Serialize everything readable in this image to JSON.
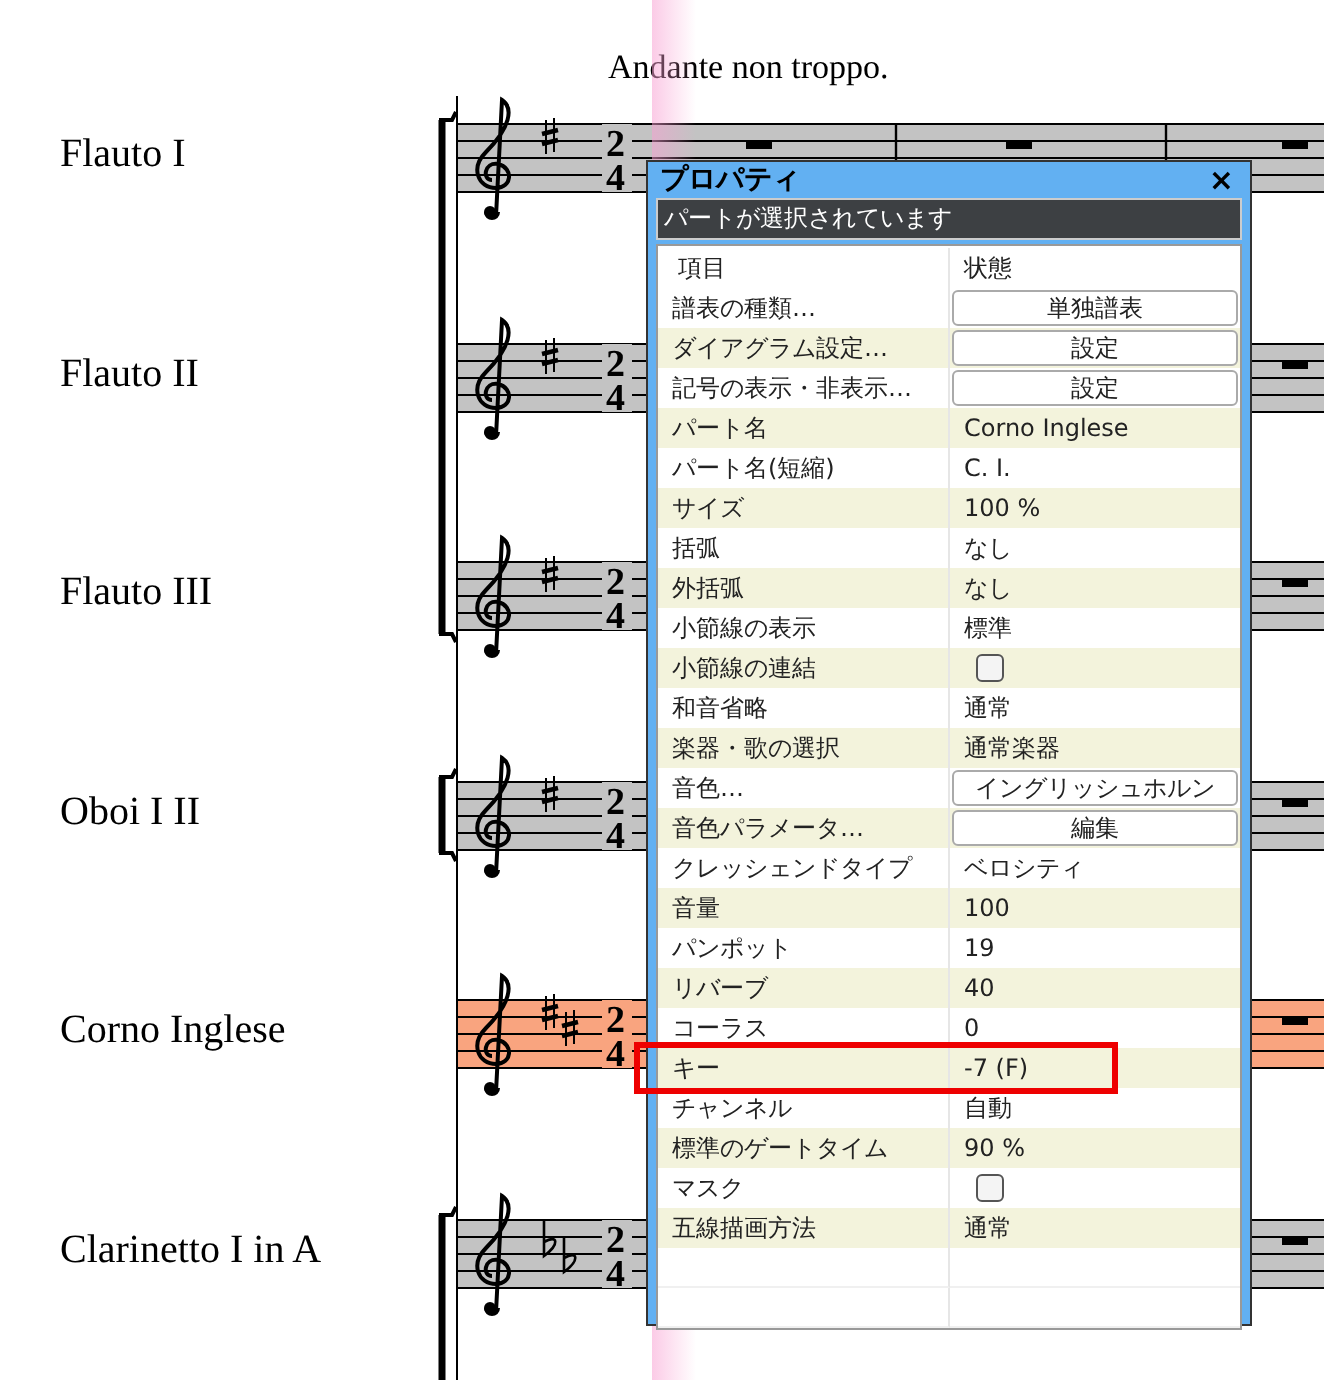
{
  "title": "Andante non troppo.",
  "staves": [
    {
      "name": "Flauto I",
      "accidentals": [
        {
          "kind": "sharp"
        }
      ],
      "time": [
        "2",
        "4"
      ],
      "selected": false
    },
    {
      "name": "Flauto II",
      "accidentals": [
        {
          "kind": "sharp"
        }
      ],
      "time": [
        "2",
        "4"
      ],
      "selected": false
    },
    {
      "name": "Flauto III",
      "accidentals": [
        {
          "kind": "sharp"
        }
      ],
      "time": [
        "2",
        "4"
      ],
      "selected": false
    },
    {
      "name": "Oboi I II",
      "accidentals": [
        {
          "kind": "sharp"
        }
      ],
      "time": [
        "2",
        "4"
      ],
      "selected": false
    },
    {
      "name": "Corno Inglese",
      "accidentals": [
        {
          "kind": "sharp"
        },
        {
          "kind": "sharp"
        }
      ],
      "time": [
        "2",
        "4"
      ],
      "selected": true
    },
    {
      "name": "Clarinetto I in A",
      "accidentals": [
        {
          "kind": "flat"
        },
        {
          "kind": "flat"
        }
      ],
      "time": [
        "2",
        "4"
      ],
      "selected": false
    }
  ],
  "panel": {
    "title": "プロパティ",
    "close": "×",
    "status": "パートが選択されています",
    "columns": [
      "項目",
      "状態"
    ],
    "rows": [
      {
        "label": "譜表の種類…",
        "value": "単独譜表",
        "kind": "button",
        "highlighted": false
      },
      {
        "label": "ダイアグラム設定…",
        "value": "設定",
        "kind": "button",
        "highlighted": false
      },
      {
        "label": "記号の表示・非表示…",
        "value": "設定",
        "kind": "button",
        "highlighted": false
      },
      {
        "label": "パート名",
        "value": "Corno Inglese",
        "kind": "text",
        "highlighted": false
      },
      {
        "label": "パート名(短縮)",
        "value": "C. I.",
        "kind": "text",
        "highlighted": false
      },
      {
        "label": "サイズ",
        "value": "100 %",
        "kind": "text",
        "highlighted": false
      },
      {
        "label": "括弧",
        "value": "なし",
        "kind": "text",
        "highlighted": false
      },
      {
        "label": "外括弧",
        "value": "なし",
        "kind": "text",
        "highlighted": false
      },
      {
        "label": "小節線の表示",
        "value": "標準",
        "kind": "text",
        "highlighted": false
      },
      {
        "label": "小節線の連結",
        "kind": "checkbox",
        "checked": false,
        "highlighted": false
      },
      {
        "label": "和音省略",
        "value": "通常",
        "kind": "text",
        "highlighted": false
      },
      {
        "label": "楽器・歌の選択",
        "value": "通常楽器",
        "kind": "text",
        "highlighted": false
      },
      {
        "label": "音色…",
        "value": "イングリッシュホルン",
        "kind": "button",
        "highlighted": false
      },
      {
        "label": "音色パラメータ…",
        "value": "編集",
        "kind": "button",
        "highlighted": false
      },
      {
        "label": "クレッシェンドタイプ",
        "value": "ベロシティ",
        "kind": "text",
        "highlighted": false
      },
      {
        "label": "音量",
        "value": "100",
        "kind": "text",
        "highlighted": false
      },
      {
        "label": "パンポット",
        "value": "19",
        "kind": "text",
        "highlighted": false
      },
      {
        "label": "リバーブ",
        "value": "40",
        "kind": "text",
        "highlighted": false
      },
      {
        "label": "コーラス",
        "value": "0",
        "kind": "text",
        "highlighted": false
      },
      {
        "label": "キー",
        "value": "-7 (F)",
        "kind": "text",
        "highlighted": true
      },
      {
        "label": "チャンネル",
        "value": "自動",
        "kind": "text",
        "highlighted": false
      },
      {
        "label": "標準のゲートタイム",
        "value": "90 %",
        "kind": "text",
        "highlighted": false
      },
      {
        "label": "マスク",
        "kind": "checkbox",
        "checked": false,
        "highlighted": false
      },
      {
        "label": "五線描画方法",
        "value": "通常",
        "kind": "text",
        "highlighted": false
      }
    ]
  }
}
